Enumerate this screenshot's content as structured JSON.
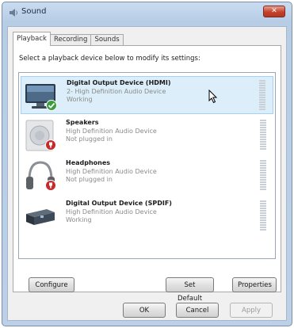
{
  "window": {
    "title": "Sound",
    "close_label": "✕"
  },
  "tabs": [
    {
      "label": "Playback",
      "active": true
    },
    {
      "label": "Recording",
      "active": false
    },
    {
      "label": "Sounds",
      "active": false
    }
  ],
  "instruction": "Select a playback device below to modify its settings:",
  "devices": [
    {
      "name": "Digital Output Device (HDMI)",
      "description": "2- High Definition Audio Device",
      "status": "Working",
      "icon": "hdmi-monitor-icon",
      "badge": "default-check-badge",
      "selected": true
    },
    {
      "name": "Speakers",
      "description": "High Definition Audio Device",
      "status": "Not plugged in",
      "icon": "speaker-icon",
      "badge": "unplugged-badge",
      "selected": false
    },
    {
      "name": "Headphones",
      "description": "High Definition Audio Device",
      "status": "Not plugged in",
      "icon": "headphones-icon",
      "badge": "unplugged-badge",
      "selected": false
    },
    {
      "name": "Digital Output Device (SPDIF)",
      "description": "High Definition Audio Device",
      "status": "Working",
      "icon": "spdif-device-icon",
      "badge": "",
      "selected": false
    }
  ],
  "buttons": {
    "configure": "Configure",
    "set_default": "Set Default",
    "properties": "Properties",
    "ok": "OK",
    "cancel": "Cancel",
    "apply": "Apply"
  },
  "colors": {
    "selection": "#dbeefa",
    "title_bar": "#c9dcf0",
    "close_button": "#c4412c"
  }
}
